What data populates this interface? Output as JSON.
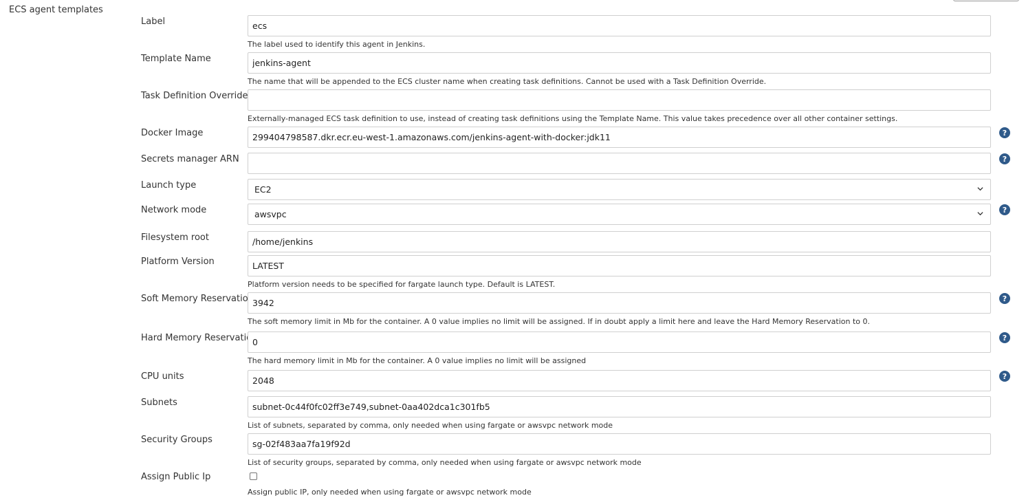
{
  "section": {
    "title": "ECS agent templates"
  },
  "help_icon": "?",
  "fields": {
    "label": {
      "label": "Label",
      "value": "ecs",
      "description": "The label used to identify this agent in Jenkins."
    },
    "template_name": {
      "label": "Template Name",
      "value": "jenkins-agent",
      "description": "The name that will be appended to the ECS cluster name when creating task definitions. Cannot be used with a Task Definition Override."
    },
    "task_def_override": {
      "label": "Task Definition Override",
      "value": "",
      "description": "Externally-managed ECS task definition to use, instead of creating task definitions using the Template Name. This value takes precedence over all other container settings."
    },
    "docker_image": {
      "label": "Docker Image",
      "value": "299404798587.dkr.ecr.eu-west-1.amazonaws.com/jenkins-agent-with-docker:jdk11"
    },
    "secrets_arn": {
      "label": "Secrets manager ARN",
      "value": ""
    },
    "launch_type": {
      "label": "Launch type",
      "value": "EC2"
    },
    "network_mode": {
      "label": "Network mode",
      "value": "awsvpc"
    },
    "fs_root": {
      "label": "Filesystem root",
      "value": "/home/jenkins"
    },
    "platform_version": {
      "label": "Platform Version",
      "value": "LATEST",
      "description": "Platform version needs to be specified for fargate launch type. Default is LATEST."
    },
    "soft_memory": {
      "label": "Soft Memory Reservation",
      "value": "3942",
      "description": "The soft memory limit in Mb for the container. A 0 value implies no limit will be assigned. If in doubt apply a limit here and leave the Hard Memory Reservation to 0."
    },
    "hard_memory": {
      "label": "Hard Memory Reservation",
      "value": "0",
      "description": "The hard memory limit in Mb for the container. A 0 value implies no limit will be assigned"
    },
    "cpu_units": {
      "label": "CPU units",
      "value": "2048"
    },
    "subnets": {
      "label": "Subnets",
      "value": "subnet-0c44f0fc02ff3e749,subnet-0aa402dca1c301fb5",
      "description": "List of subnets, separated by comma, only needed when using fargate or awsvpc network mode"
    },
    "security_groups": {
      "label": "Security Groups",
      "value": "sg-02f483aa7fa19f92d",
      "description": "List of security groups, separated by comma, only needed when using fargate or awsvpc network mode"
    },
    "assign_public_ip": {
      "label": "Assign Public Ip",
      "checked": false,
      "description": "Assign public IP, only needed when using fargate or awsvpc network mode"
    }
  }
}
